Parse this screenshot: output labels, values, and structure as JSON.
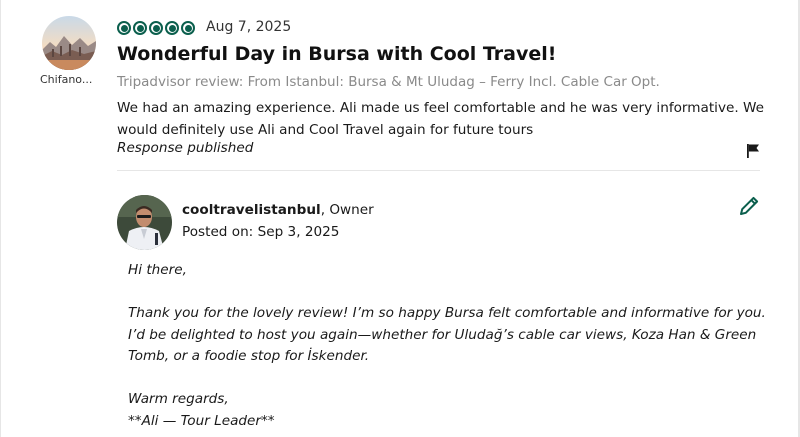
{
  "review": {
    "reviewer_name": "Chifano...",
    "rating": 5,
    "rating_max": 5,
    "date": "Aug 7, 2025",
    "title": "Wonderful Day in Bursa with Cool Travel!",
    "source": "Tripadvisor review: From Istanbul: Bursa & Mt Uludag – Ferry Incl. Cable Car Opt.",
    "body": "We had an amazing experience. Ali made us feel comfortable and he was very informative. We would definitely use Ali and Cool Travel again for future tours",
    "response_status": "Response published"
  },
  "response": {
    "owner_name": "cooltravelistanbul",
    "owner_role": ", Owner",
    "posted_label": "Posted on:",
    "posted_date": "Sep 3, 2025",
    "greeting": "Hi there,",
    "paragraph": "Thank you for the lovely review! I’m so happy Bursa felt comfortable and informative for you. I’d be delighted to host you again—whether for Uludağ’s cable car views, Koza Han & Green Tomb, or a foodie stop for İskender.",
    "signoff": "Warm regards,",
    "signature": "**Ali — Tour Leader**"
  },
  "icons": {
    "flag": "flag-icon",
    "edit": "pencil-edit-icon",
    "rating": "rating-bubble-icon"
  },
  "colors": {
    "rating_green": "#0b5f4d",
    "muted_text": "#8a8a8a",
    "edit_icon": "#0b5f4d"
  }
}
